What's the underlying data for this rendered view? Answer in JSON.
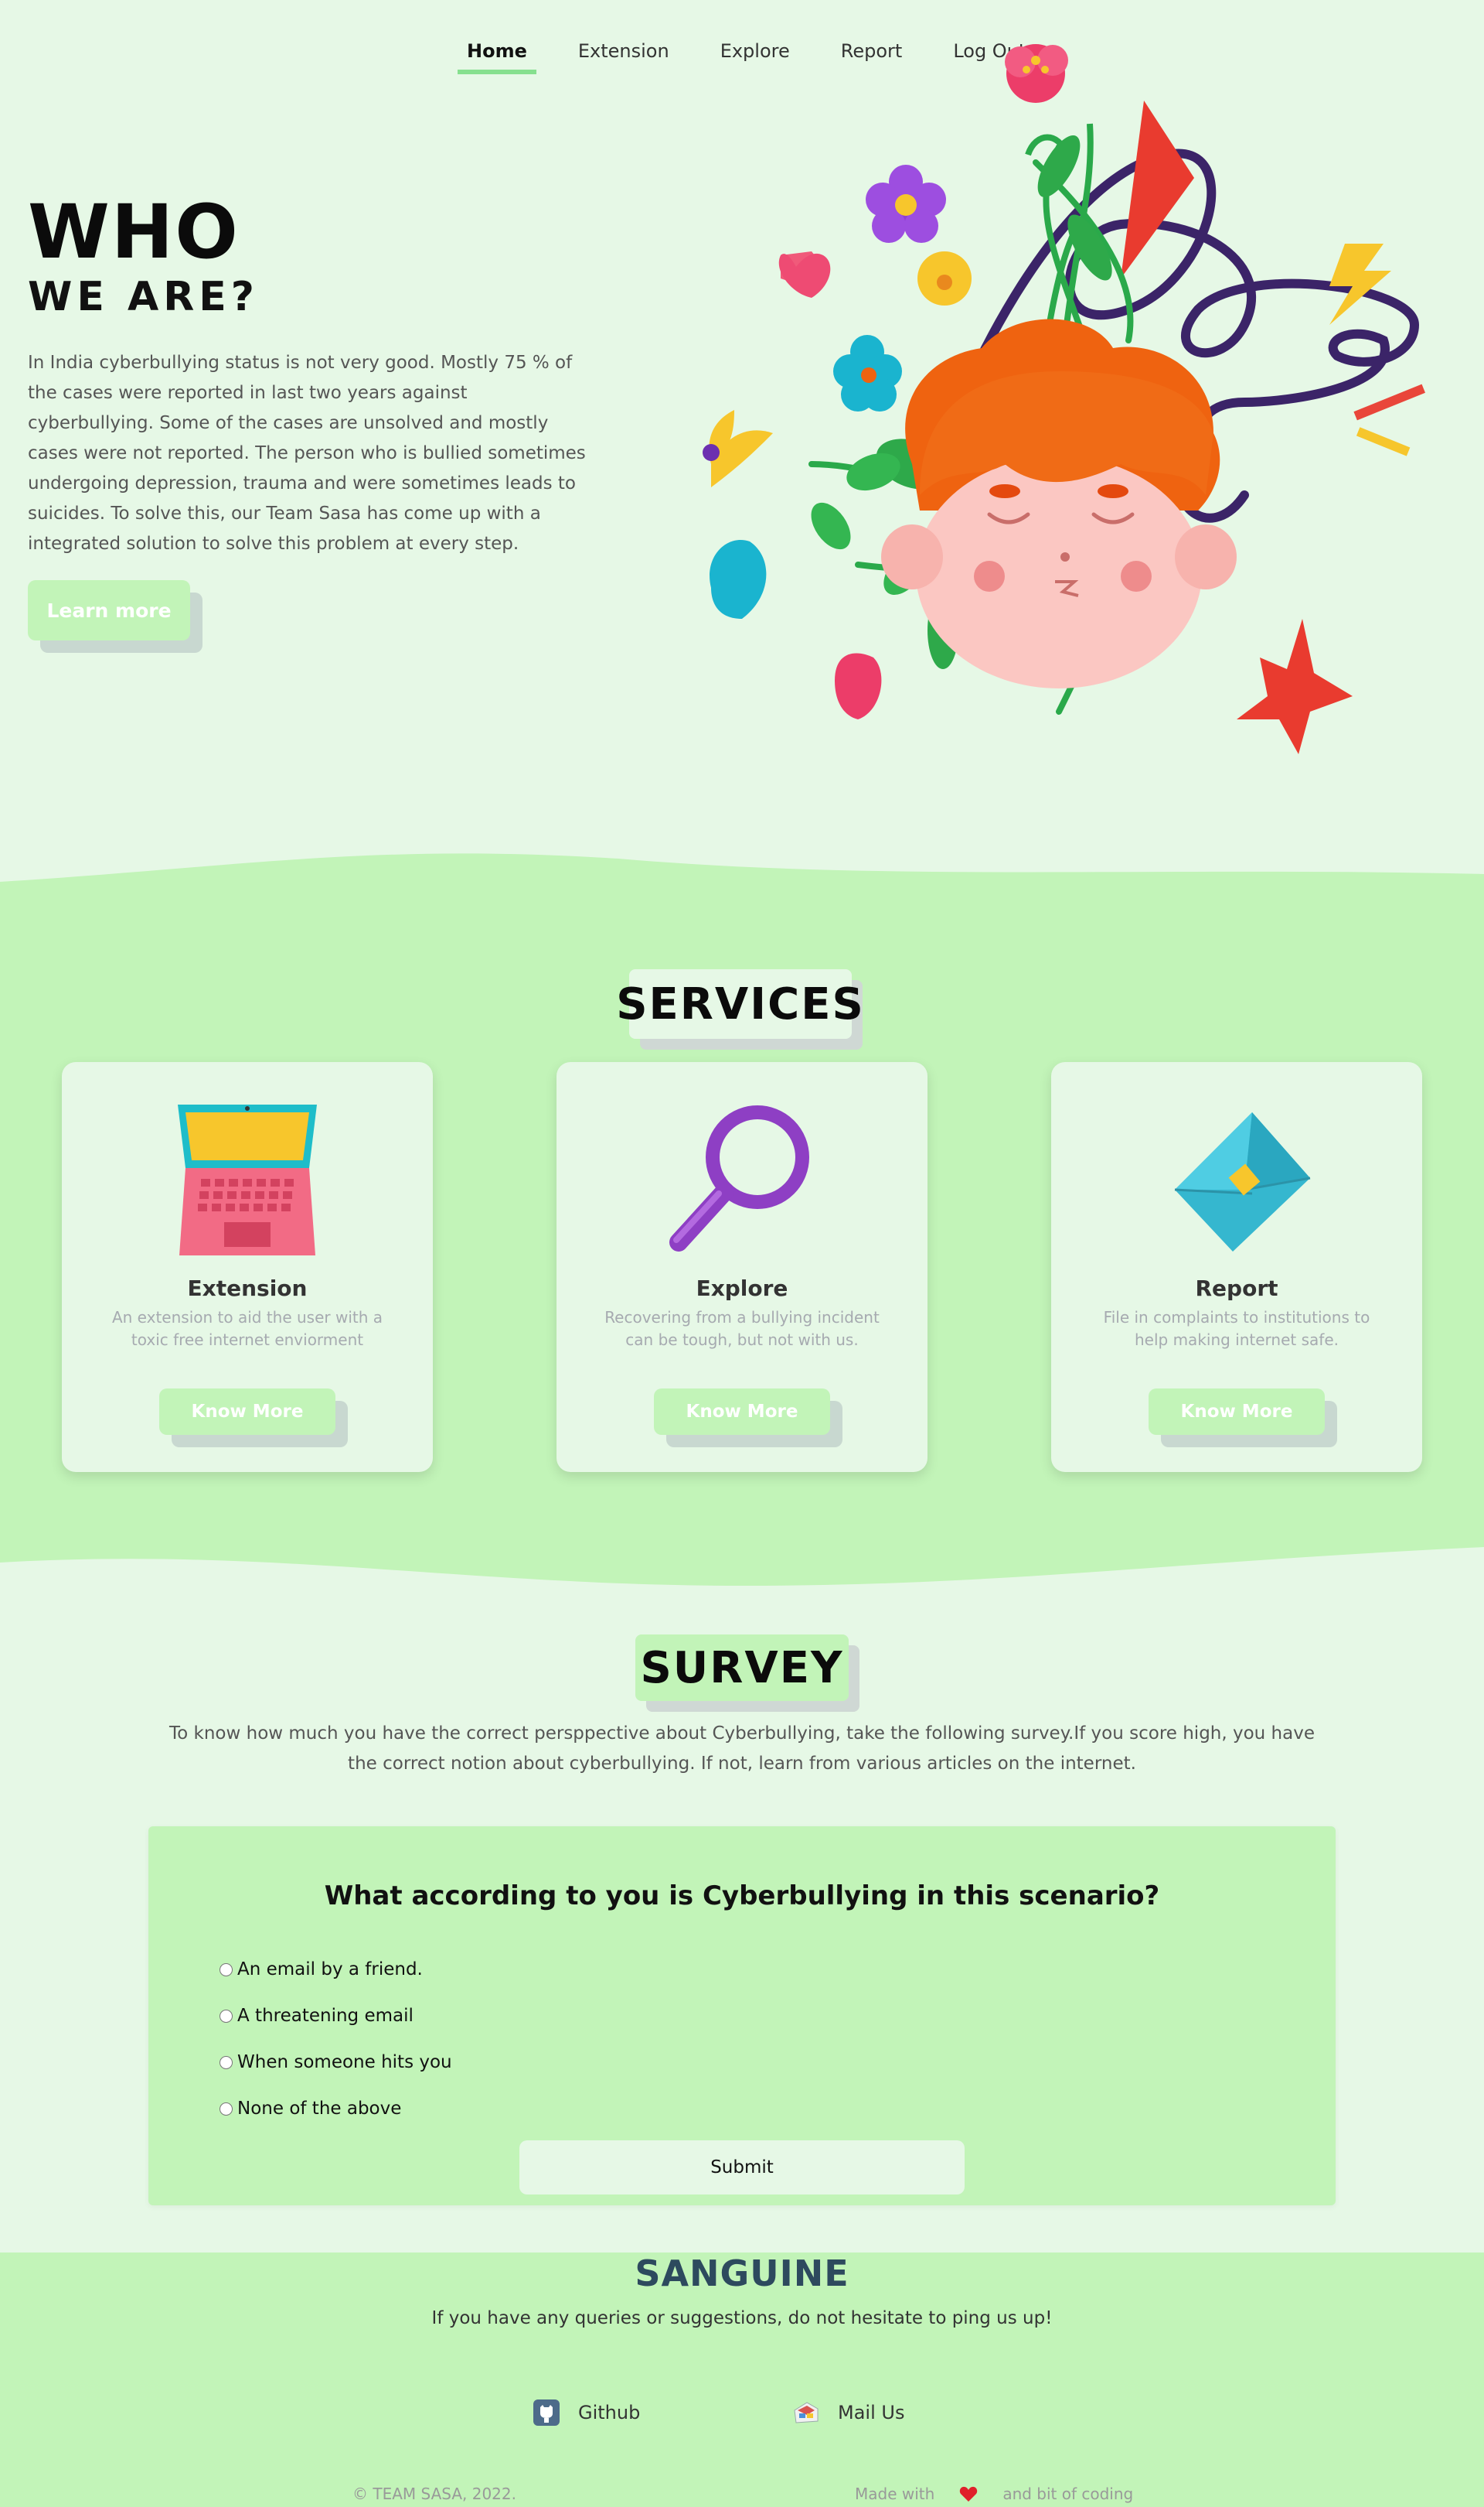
{
  "nav": {
    "items": [
      {
        "label": "Home",
        "active": true
      },
      {
        "label": "Extension",
        "active": false
      },
      {
        "label": "Explore",
        "active": false
      },
      {
        "label": "Report",
        "active": false
      },
      {
        "label": "Log Out",
        "active": false
      }
    ]
  },
  "hero": {
    "title": "WHO",
    "subtitle": "WE ARE?",
    "text": "In India cyberbullying status is not very good. Mostly 75 % of the cases were reported in last two years against cyberbullying. Some of the cases are unsolved and mostly cases were not reported. The person who is bullied sometimes undergoing depression, trauma and were sometimes leads to suicides. To solve this, our Team Sasa has come up with a integrated solution to solve this problem at every step.",
    "button_label": "Learn more",
    "illustration_icon": "boy-with-flowers-illustration"
  },
  "services": {
    "title": "SERVICES",
    "cards": [
      {
        "icon": "laptop-icon",
        "title": "Extension",
        "desc": "An extension to aid the user with a toxic free internet enviorment",
        "button": "Know More"
      },
      {
        "icon": "magnifier-icon",
        "title": "Explore",
        "desc": "Recovering from a bullying incident can be tough, but not with us.",
        "button": "Know More"
      },
      {
        "icon": "envelope-icon",
        "title": "Report",
        "desc": "File in complaints to institutions to help making internet safe.",
        "button": "Know More"
      }
    ]
  },
  "survey": {
    "title": "SURVEY",
    "desc": "To know how much you have the correct persppective about Cyberbullying, take the following survey.If you score high, you have the correct notion about cyberbullying. If not, learn from various articles on the internet.",
    "question": "What according to you is Cyberbullying in this scenario?",
    "options": [
      "An email by a friend.",
      "A threatening email",
      "When someone hits you",
      "None of the above"
    ],
    "submit": "Submit"
  },
  "footer": {
    "brand": "SANGUINE",
    "tagline": "If you have any queries or suggestions, do not hesitate to ping us up!",
    "links": [
      {
        "label": "Github",
        "icon": "github-icon"
      },
      {
        "label": "Mail Us",
        "icon": "mail-icon"
      }
    ],
    "copyright": "© TEAM SASA, 2022.",
    "made_prefix": "Made with",
    "made_suffix": "and bit of coding",
    "heart_icon": "heart-icon"
  },
  "colors": {
    "page_bg": "#e6f8e6",
    "accent_green": "#c2f4b8",
    "nav_underline": "#86e08f",
    "button_shadow": "#c8d8d0"
  }
}
